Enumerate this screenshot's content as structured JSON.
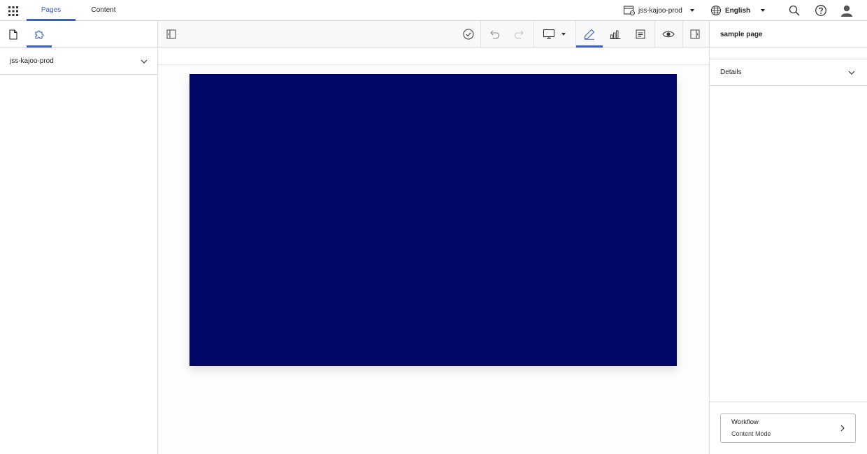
{
  "topbar": {
    "tabs": [
      {
        "label": "Pages",
        "active": true
      },
      {
        "label": "Content",
        "active": false
      }
    ],
    "site_selector": {
      "label": "jss-kajoo-prod",
      "icon": "site-icon"
    },
    "language_selector": {
      "label": "English",
      "icon": "globe-icon"
    },
    "icons": [
      "apps-grid-icon",
      "search-icon",
      "help-icon",
      "user-avatar-icon"
    ]
  },
  "left_panel": {
    "tabs": [
      {
        "icon": "page-icon",
        "active": false
      },
      {
        "icon": "puzzle-icon",
        "active": true
      }
    ],
    "site_dropdown": {
      "label": "jss-kajoo-prod"
    }
  },
  "toolbar": {
    "icons": [
      "collapse-left-panel-icon",
      "approve-check-icon",
      "undo-icon",
      "redo-icon",
      "device-desktop-icon",
      "edit-pencil-icon",
      "analytics-icon",
      "page-details-icon",
      "preview-eye-icon",
      "collapse-right-panel-icon"
    ],
    "active_mode": "edit"
  },
  "canvas": {
    "frame_color": "#000766"
  },
  "right_panel": {
    "title": "sample page",
    "details_label": "Details",
    "workflow": {
      "title": "Workflow",
      "subtitle": "Content Mode"
    }
  },
  "colors": {
    "accent": "#3b62c6",
    "border": "#d9d9d9"
  }
}
